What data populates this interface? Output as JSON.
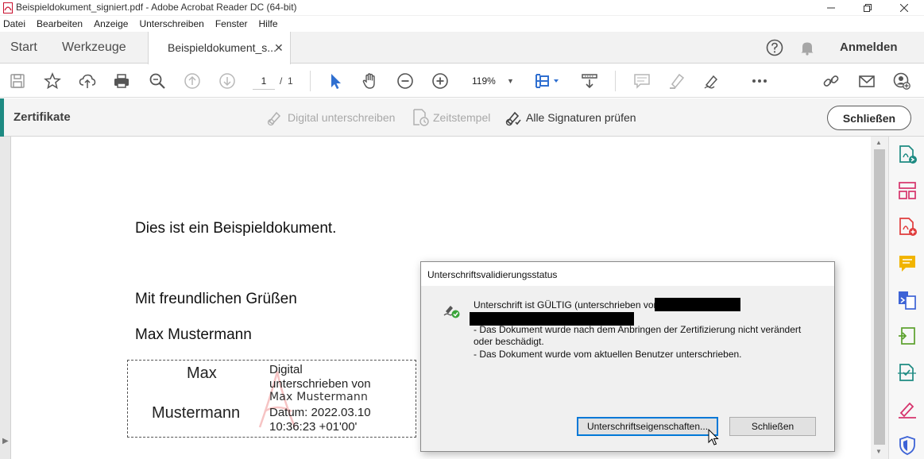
{
  "window": {
    "title": "Beispieldokument_signiert.pdf - Adobe Acrobat Reader DC (64-bit)",
    "controls": [
      "minimize",
      "maximize",
      "close"
    ]
  },
  "menu": [
    "Datei",
    "Bearbeiten",
    "Anzeige",
    "Unterschreiben",
    "Fenster",
    "Hilfe"
  ],
  "tabs": {
    "home": "Start",
    "tools": "Werkzeuge",
    "document": "Beispieldokument_s...",
    "document_close": "✕",
    "signin": "Anmelden"
  },
  "toolbar": {
    "page_current": "1",
    "page_separator": "/",
    "page_total": "1",
    "zoom": "119%",
    "icons": [
      "save-icon",
      "bookmark-star-icon",
      "upload-cloud-icon",
      "print-icon",
      "zoom-search-icon",
      "page-up-icon",
      "page-down-icon",
      "select-cursor-icon",
      "hand-icon",
      "zoom-out-icon",
      "zoom-in-icon",
      "page-fit-icon",
      "scroll-mode-icon",
      "comment-icon",
      "highlight-icon",
      "sign-icon",
      "more-icon",
      "share-link-icon",
      "email-icon",
      "add-user-icon"
    ]
  },
  "certbar": {
    "title": "Zertifikate",
    "sign_digital": "Digital unterschreiben",
    "timestamp": "Zeitstempel",
    "verify_all": "Alle Signaturen prüfen",
    "close": "Schließen"
  },
  "document": {
    "line1": "Dies ist ein Beispieldokument.",
    "greeting": "Mit freundlichen Grüßen",
    "name": "Max Mustermann",
    "signature": {
      "name_part1": "Max",
      "name_part2": "Mustermann",
      "info_line1": "Digital",
      "info_line2": "unterschrieben von",
      "info_line3": "Max Mustermann",
      "info_line4": "Datum: 2022.03.10",
      "info_line5": "10:36:23 +01'00'"
    }
  },
  "dialog": {
    "title": "Unterschriftsvalidierungsstatus",
    "line1": "Unterschrift ist GÜLTIG (unterschrieben von",
    "line2": "- Das Dokument wurde nach dem Anbringen der Zertifizierung nicht verändert",
    "line3": "oder beschädigt.",
    "line4": "- Das Dokument wurde vom aktuellen Benutzer unterschrieben.",
    "properties_button": "Unterschriftseigenschaften...",
    "close_button": "Schließen"
  },
  "colors": {
    "accent_teal": "#1d8a82",
    "valid_green": "#3aa53a",
    "toolbar_blue": "#2f6fd0",
    "sidebar_pink": "#d6336c",
    "sidebar_yellow": "#f1b400"
  }
}
